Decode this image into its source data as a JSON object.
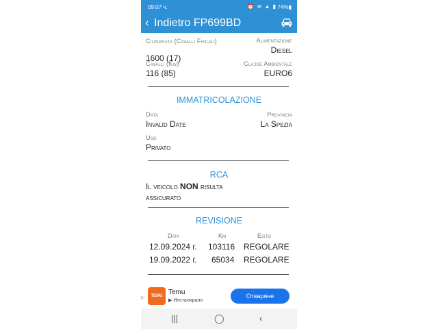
{
  "status": {
    "time": "09:07 ч.",
    "icons": "⏰ ≋ ▲ ▮",
    "battery": "74%▮"
  },
  "appbar": {
    "back_glyph": "‹",
    "title": "Indietro FP699BD"
  },
  "vehicle": {
    "cilindrata_label": "Cilindrata (Cavalli Fiscali)",
    "cilindrata_value": "1600 (17)",
    "alimentazione_label": "Alimentazione",
    "alimentazione_value": "Diesel",
    "cavalli_label": "Cavalli (Kw)",
    "cavalli_value": "116 (85)",
    "classe_label": "Classe Ambientale",
    "classe_value": "EURO6"
  },
  "immatricolazione": {
    "title": "IMMATRICOLAZIONE",
    "data_label": "Data",
    "data_value": "Invalid Date",
    "provincia_label": "Provincia",
    "provincia_value": "La Spezia",
    "uso_label": "Uso",
    "uso_value": "Privato"
  },
  "rca": {
    "title": "RCA",
    "text_before": "Il veicolo ",
    "text_bold": "NON",
    "text_after": " risulta",
    "text_line2": "assicurato"
  },
  "revisione": {
    "title": "REVISIONE",
    "headers": [
      "Data",
      "Km",
      "Esito"
    ],
    "rows": [
      [
        "12.09.2024 г.",
        "103116",
        "REGOLARE"
      ],
      [
        "19.09.2022 г.",
        "65034",
        "REGOLARE"
      ]
    ]
  },
  "ad": {
    "icon_text": "TEMU",
    "app_name": "Temu",
    "app_sub": "▶ Инсталирано",
    "cta": "Отваряне"
  },
  "navbar": {
    "recent": "|||",
    "home": "◯",
    "back": "‹"
  }
}
